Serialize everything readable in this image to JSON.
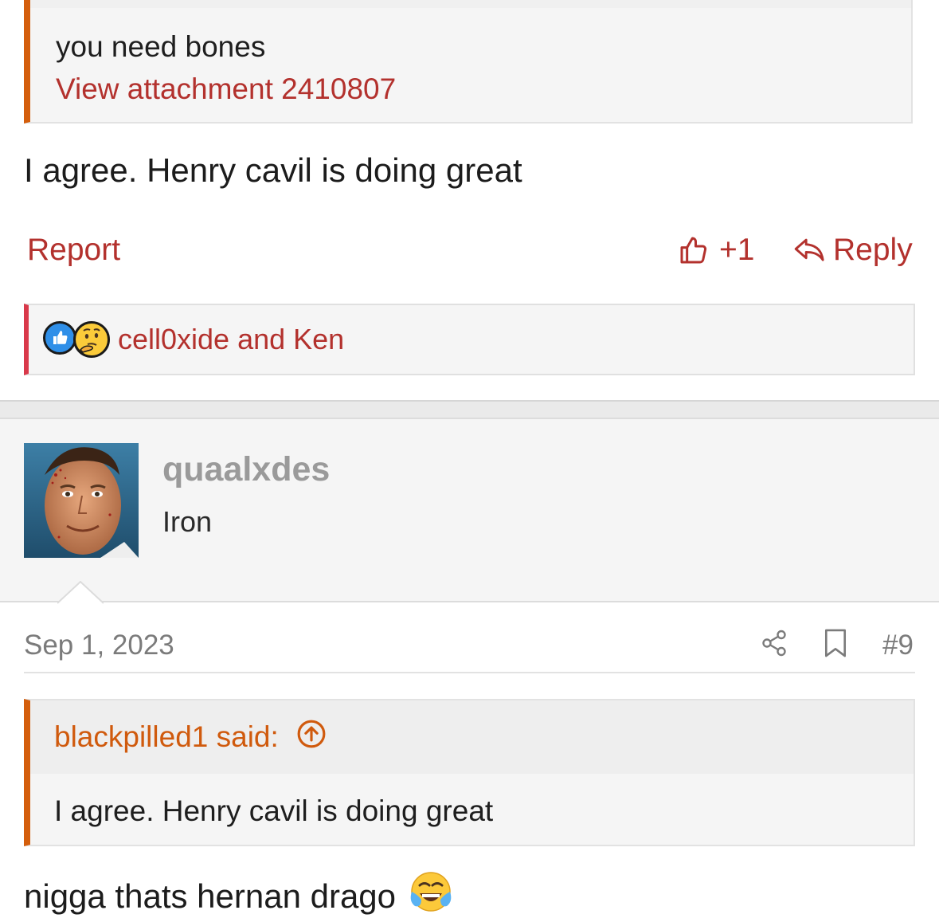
{
  "prev_post": {
    "quote_text": "you need bones",
    "quote_attachment_link": "View attachment 2410807",
    "message": "I agree. Henry cavil is doing great",
    "actions": {
      "report_label": "Report",
      "like_label": "+1",
      "reply_label": "Reply"
    },
    "reactions": {
      "icons": [
        "like-icon",
        "thinking-face-icon"
      ],
      "names": "cell0xide and Ken"
    }
  },
  "next_post": {
    "user": {
      "name": "quaalxdes",
      "title": "Iron"
    },
    "meta": {
      "date": "Sep 1, 2023",
      "post_number": "#9",
      "icons": [
        "share-icon",
        "bookmark-icon"
      ]
    },
    "quote": {
      "author_line": "blackpilled1 said:",
      "text": "I agree. Henry cavil is doing great"
    },
    "message": "nigga thats hernan drago",
    "message_emoji": "face-with-tears-of-joy"
  },
  "colors": {
    "link": "#b3312d",
    "quote_accent": "#d45e0c",
    "reaction_accent": "#d9394a",
    "muted": "#7b7b7b"
  }
}
